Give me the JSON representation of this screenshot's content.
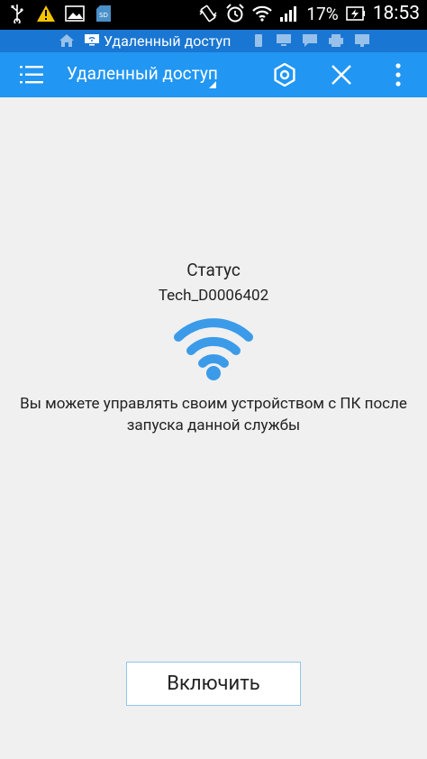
{
  "status_bar": {
    "battery_percent": "17%",
    "time": "18:53"
  },
  "breadcrumb": {
    "active_label": "Удаленный доступ"
  },
  "toolbar": {
    "title": "Удаленный доступ"
  },
  "content": {
    "status_label": "Статус",
    "device_name": "Tech_D0006402",
    "description": "Вы можете управлять своим устройством с ПК после запуска данной службы",
    "enable_button": "Включить"
  },
  "colors": {
    "toolbar": "#2196f3",
    "breadcrumb": "#1976d2",
    "accent": "#2196f3",
    "warning": "#f5c400"
  }
}
